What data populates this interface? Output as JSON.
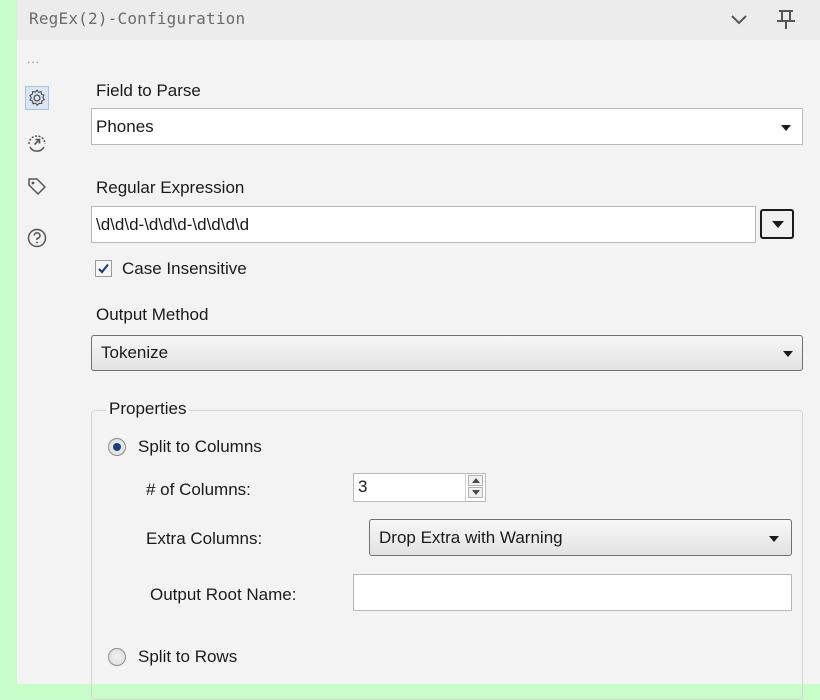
{
  "panel": {
    "title": "RegEx(2)-Configuration",
    "menu_dots": "...",
    "side_icons": [
      "gear-icon",
      "output-arrow-icon",
      "tag-icon",
      "help-icon"
    ]
  },
  "field_to_parse": {
    "label": "Field to Parse",
    "value": "Phones"
  },
  "regular_expression": {
    "label": "Regular Expression",
    "value": "\\d\\d\\d-\\d\\d\\d-\\d\\d\\d\\d"
  },
  "case_insensitive": {
    "label": "Case Insensitive",
    "checked": true
  },
  "output_method": {
    "label": "Output Method",
    "value": "Tokenize"
  },
  "properties": {
    "legend": "Properties",
    "split_to_columns": {
      "label": "Split to Columns",
      "selected": true
    },
    "num_columns": {
      "label": "# of Columns:",
      "value": "3"
    },
    "extra_columns": {
      "label": "Extra Columns:",
      "value": "Drop Extra with Warning"
    },
    "output_root_name": {
      "label": "Output Root Name:",
      "value": ""
    },
    "split_to_rows": {
      "label": "Split to Rows",
      "selected": false
    }
  },
  "colors": {
    "background": "#c8fcc8",
    "panel": "#f3f3f4",
    "accent": "#1f3e7a"
  }
}
